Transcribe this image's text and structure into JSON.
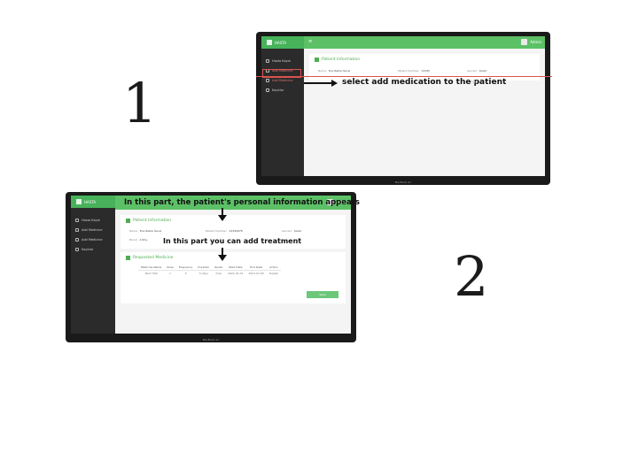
{
  "steps": {
    "one": "1",
    "two": "2"
  },
  "app": {
    "logo": "HASTA",
    "user": "Admin",
    "sidebar": [
      {
        "label": "Hasta Kaydı"
      },
      {
        "label": "Add Medicine"
      },
      {
        "label": "Add Medicine"
      },
      {
        "label": "Kayıtlar"
      }
    ]
  },
  "screen1": {
    "panel_title": "Patient Information",
    "fields": [
      {
        "label": "Name:",
        "value": "Ece Rabia Yavuz"
      },
      {
        "label": "Patient Number:",
        "value": "12345"
      },
      {
        "label": "Gender:",
        "value": "Kadın"
      }
    ],
    "annotation": "select add medication to the patient",
    "menu_hint": "Add",
    "caption": "MacBook Air"
  },
  "screen2": {
    "panel_title": "Patient Information",
    "fields": [
      {
        "label": "Name:",
        "value": "Ece Rabia Yavuz"
      },
      {
        "label": "Patient Number:",
        "value": "12345678"
      },
      {
        "label": "Gender:",
        "value": "Kadın"
      },
      {
        "label": "Blood:",
        "value": "A Rh+"
      }
    ],
    "annotation_top": "In this part, the patient's personal information appears",
    "annotation_mid": "In this part you can add treatment",
    "treatment_title": "Requested Medicine",
    "table": {
      "headers": [
        "Medicine Name",
        "Dose",
        "Frequency",
        "Duration",
        "Route",
        "Start Date",
        "End Date",
        "Action"
      ],
      "rows": [
        [
          "Parol 500",
          "1",
          "3",
          "5 days",
          "Oral",
          "2021-01-01",
          "2021-01-05",
          "Delete"
        ]
      ]
    },
    "save_label": "Save",
    "caption": "MacBook Air"
  },
  "colors": {
    "accent": "#5cc166",
    "sidebar": "#2b2b2b",
    "highlight": "#d9534f"
  }
}
